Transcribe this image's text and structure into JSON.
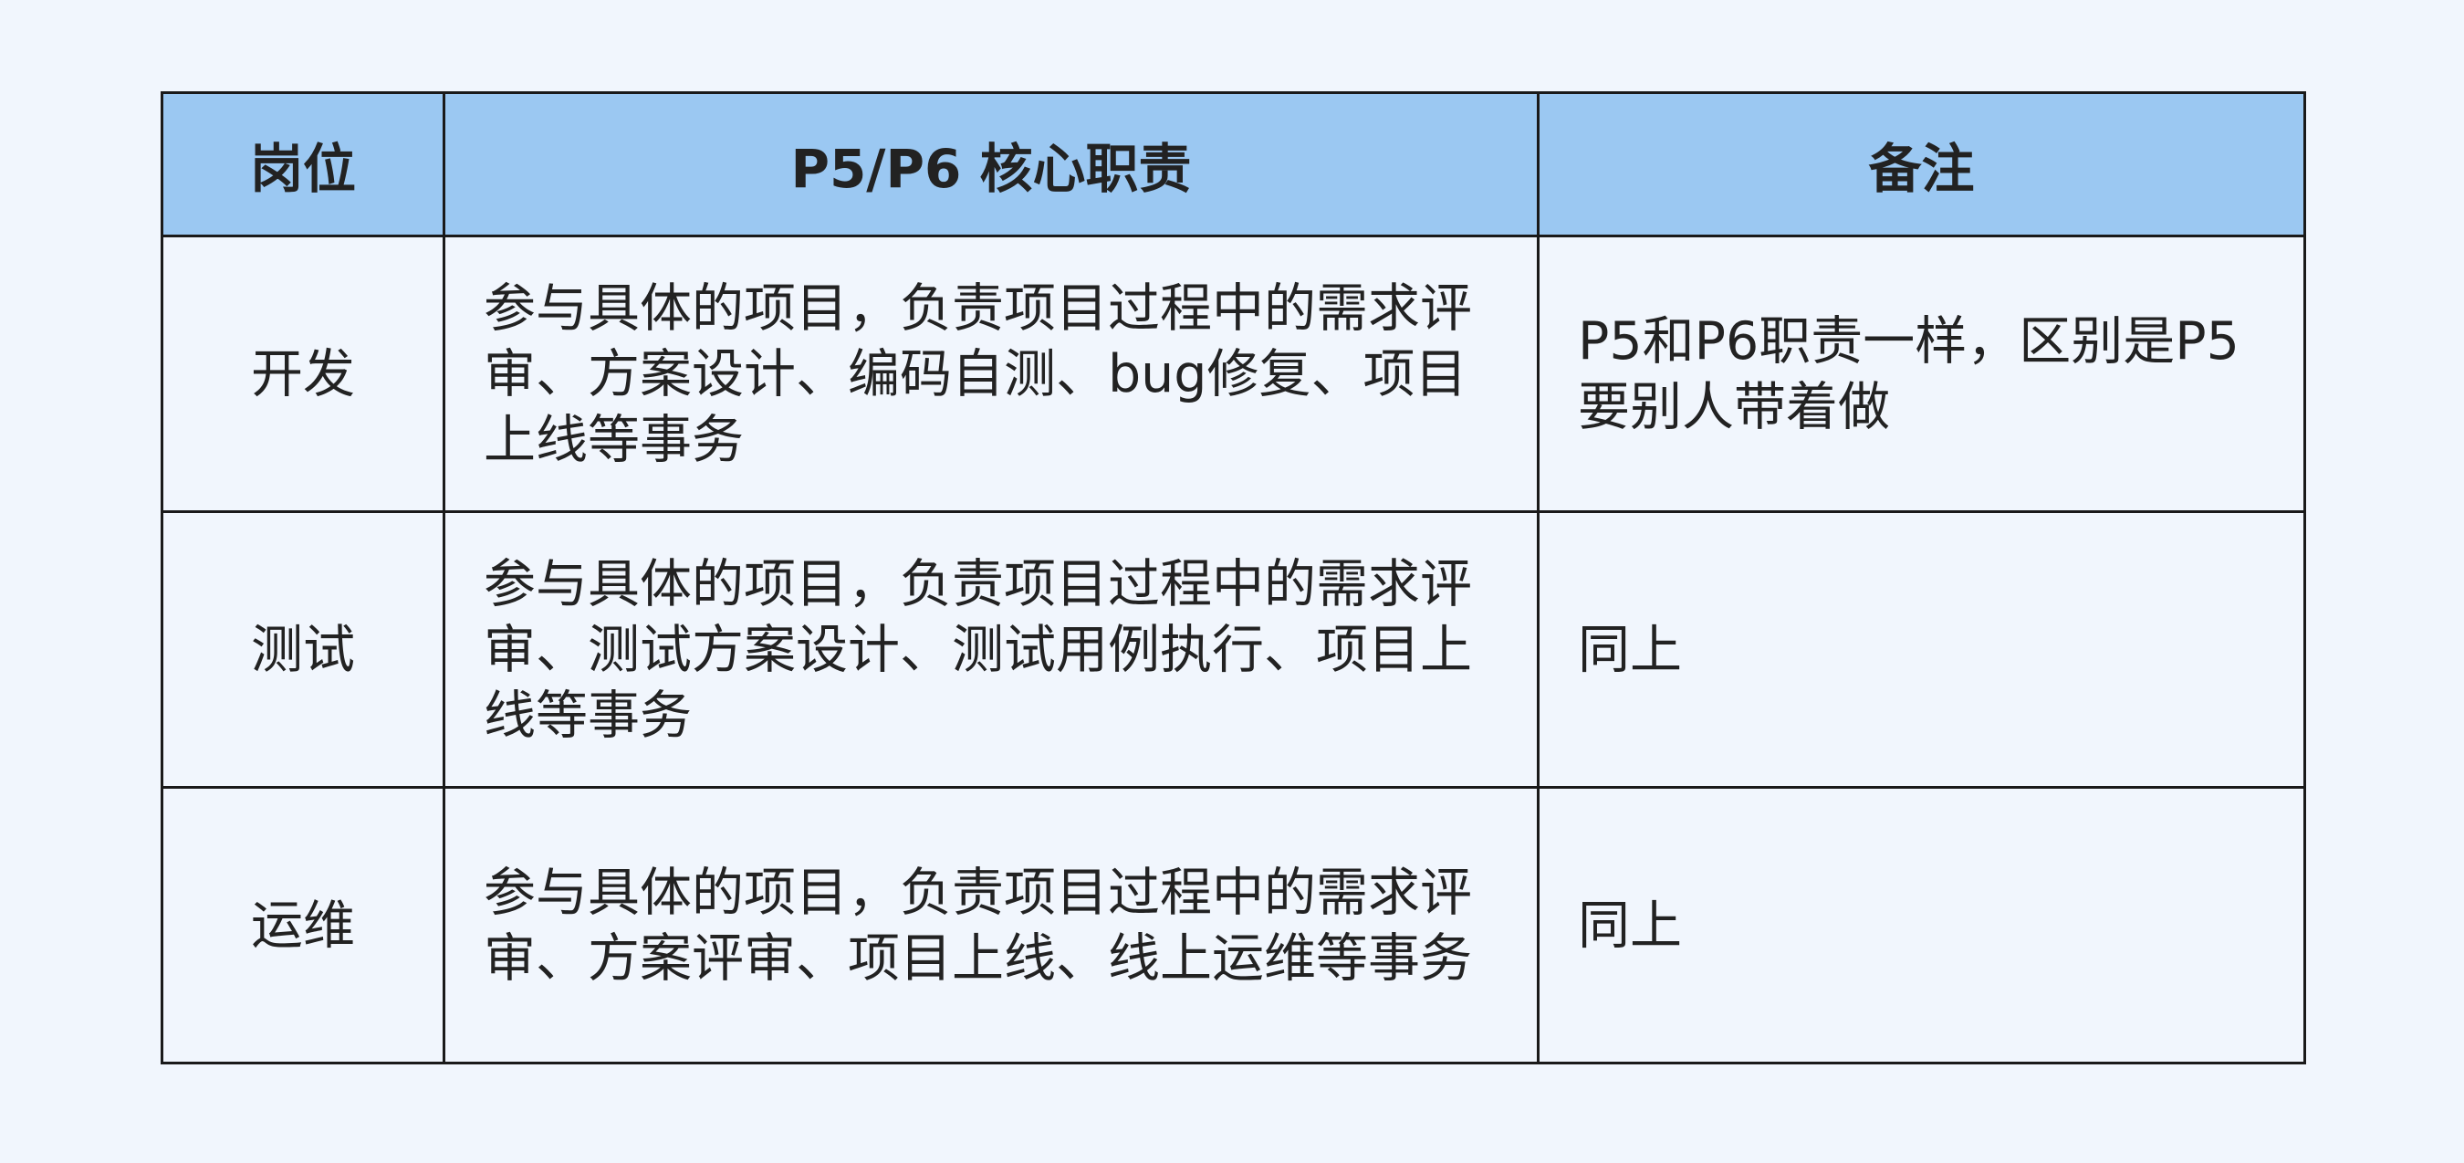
{
  "table": {
    "headers": [
      "岗位",
      "P5/P6 核心职责",
      "备注"
    ],
    "rows": [
      {
        "role": "开发",
        "duty": "参与具体的项目，负责项目过程中的需求评审、方案设计、编码自测、bug修复、项目上线等事务",
        "note": "P5和P6职责一样，区别是P5要别人带着做"
      },
      {
        "role": "测试",
        "duty": "参与具体的项目，负责项目过程中的需求评审、测试方案设计、测试用例执行、项目上线等事务",
        "note": "同上"
      },
      {
        "role": "运维",
        "duty": "参与具体的项目，负责项目过程中的需求评审、方案评审、项目上线、线上运维等事务",
        "note": "同上"
      }
    ]
  },
  "colors": {
    "background": "#f1f6fd",
    "header_fill": "#9bc8f2",
    "border": "#1a1a1a",
    "text": "#222222"
  }
}
